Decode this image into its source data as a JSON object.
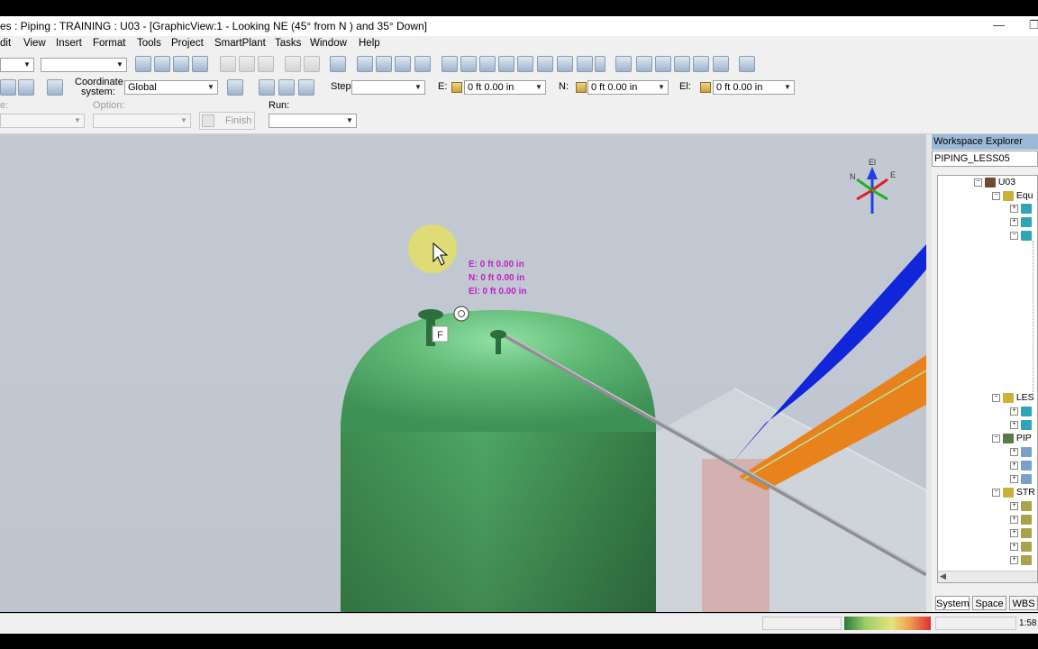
{
  "titlebar": {
    "title": "es : Piping : TRAINING : U03 - [GraphicView:1 - Looking NE (45° from N ) and 35° Down]",
    "minimize": "—",
    "maximize": "❐"
  },
  "menu": [
    "dit",
    "View",
    "Insert",
    "Format",
    "Tools",
    "Project",
    "SmartPlant",
    "Tasks",
    "Window",
    "Help"
  ],
  "toolbar2": {
    "coordinate_label_1": "Coordinate",
    "coordinate_label_2": "system:",
    "coordinate_value": "Global",
    "step_label": "Step:",
    "step_value": "",
    "e_label": "E:",
    "e_value": "0 ft  0.00 in",
    "n_label": "N:",
    "n_value": "0 ft  0.00 in",
    "el_label": "El:",
    "el_value": "0 ft  0.00 in"
  },
  "toolbar3": {
    "type_label": "e:",
    "option_label": "Option:",
    "finish_label": "Finish",
    "run_label": "Run:"
  },
  "viewport": {
    "position_readout": [
      "E: 0 ft  0.00 in",
      "N: 0 ft  0.00 in",
      "El: 0 ft  0.00 in"
    ],
    "nozzle_label": "F",
    "compass": {
      "up": "El",
      "left": "N",
      "right": "E"
    },
    "colors": {
      "vessel": "#5fb874",
      "blue_pipe": "#1026d8",
      "orange_pipe": "#e8821c",
      "readout": "#c020c0"
    }
  },
  "explorer": {
    "title": "Workspace Explorer",
    "filter": "PIPING_LESS05",
    "tree": [
      {
        "label": "U03"
      },
      {
        "label": "Equ"
      },
      {
        "label": "LES"
      },
      {
        "label": "PIP"
      },
      {
        "label": "STR"
      }
    ],
    "tabs": [
      "System",
      "Space",
      "WBS"
    ]
  },
  "statusbar": {
    "time": "1:58"
  }
}
